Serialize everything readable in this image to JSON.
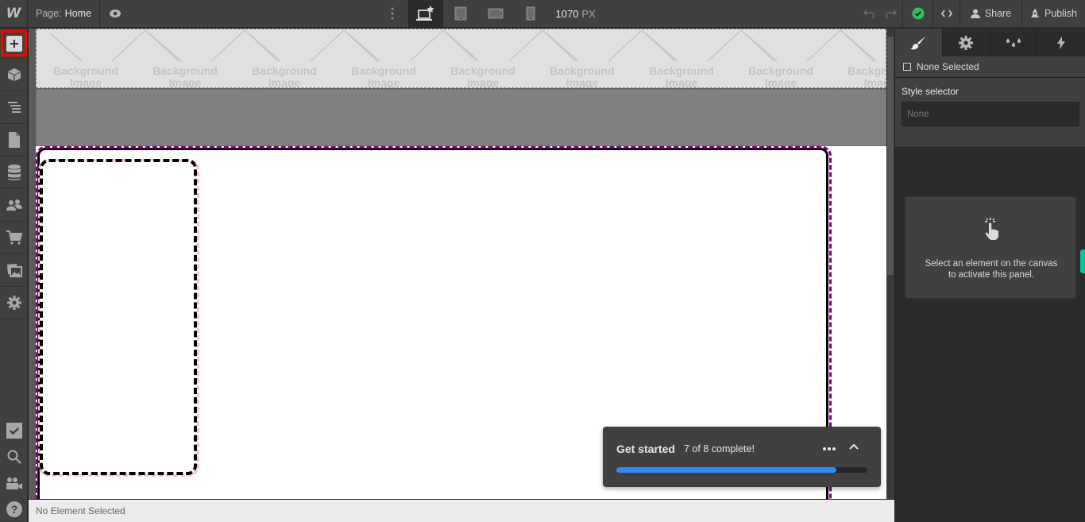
{
  "topbar": {
    "logo": "W",
    "page_prefix": "Page:",
    "page_name": "Home",
    "canvas_width_value": "1070",
    "canvas_width_unit": "PX",
    "share_label": "Share",
    "publish_label": "Publish",
    "status_color": "#2fbf5b",
    "icons": [
      "preview-eye-icon",
      "more-vertical-icon",
      "desktop-base-icon",
      "tablet-icon",
      "mobile-landscape-icon",
      "mobile-portrait-icon",
      "undo-icon",
      "redo-icon",
      "check-icon",
      "code-icon",
      "user-icon",
      "rocket-icon"
    ]
  },
  "leftbar": {
    "items": [
      {
        "name": "add-panel",
        "icon": "plus-icon"
      },
      {
        "name": "symbols",
        "icon": "cube-icon"
      },
      {
        "name": "navigator",
        "icon": "layers-icon"
      },
      {
        "name": "pages",
        "icon": "page-icon"
      },
      {
        "name": "cms",
        "icon": "database-icon"
      },
      {
        "name": "users",
        "icon": "users-icon"
      },
      {
        "name": "ecommerce",
        "icon": "cart-icon"
      },
      {
        "name": "assets",
        "icon": "images-icon"
      },
      {
        "name": "settings",
        "icon": "gear-icon"
      }
    ],
    "bottom_items": [
      {
        "name": "audit",
        "icon": "checkbox-icon"
      },
      {
        "name": "search",
        "icon": "search-icon"
      },
      {
        "name": "tutorials",
        "icon": "video-icon"
      },
      {
        "name": "help",
        "icon": "help-icon"
      }
    ],
    "highlight_color": "#ff0000"
  },
  "canvas": {
    "bg_placeholder_line1": "Background",
    "bg_placeholder_line2": "Image",
    "bg_placeholder_count": 9
  },
  "statusbar": {
    "text": "No Element Selected"
  },
  "toast": {
    "title": "Get started",
    "progress_text": "7 of 8 complete!",
    "completed": 7,
    "total": 8,
    "progress_fraction": 0.875,
    "progress_color": "#2d8ef0"
  },
  "rightpanel": {
    "tabs": [
      {
        "name": "style",
        "icon": "brush-icon",
        "active": true
      },
      {
        "name": "element-settings",
        "icon": "gear-icon",
        "active": false
      },
      {
        "name": "style-manager",
        "icon": "drops-icon",
        "active": false
      },
      {
        "name": "interactions",
        "icon": "lightning-icon",
        "active": false
      }
    ],
    "selection_label": "None Selected",
    "style_selector_label": "Style selector",
    "style_selector_placeholder": "None",
    "empty_message_line1": "Select an element on the canvas",
    "empty_message_line2": "to activate this panel."
  }
}
